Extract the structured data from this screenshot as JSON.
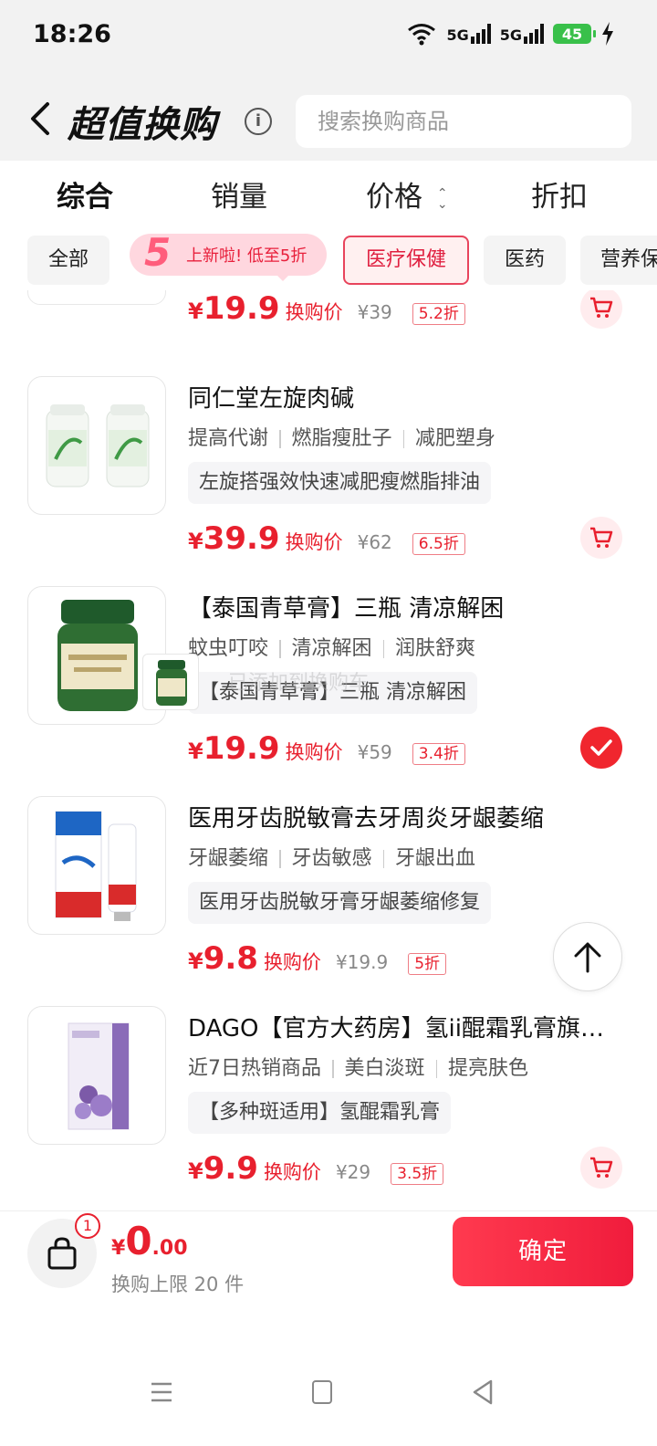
{
  "status": {
    "time": "18:26",
    "signal1": "5G",
    "signal2": "5G",
    "battery": "45"
  },
  "header": {
    "title": "超值换购",
    "search_placeholder": "搜索换购商品"
  },
  "sort": {
    "tabs": [
      "综合",
      "销量",
      "价格",
      "折扣"
    ]
  },
  "categories": [
    "全部",
    "医疗保健",
    "医药",
    "营养保健"
  ],
  "promo": {
    "num": "5",
    "text": "上新啦! 低至5折"
  },
  "items": [
    {
      "name": "",
      "tags": [],
      "desc": "",
      "price": "19.9",
      "price_label": "换购价",
      "orig": "¥39",
      "discount": "5.2折",
      "selected": false
    },
    {
      "name": "同仁堂左旋肉碱",
      "tags": [
        "提高代谢",
        "燃脂瘦肚子",
        "减肥塑身"
      ],
      "desc": "左旋搭强效快速减肥瘦燃脂排油",
      "price": "39.9",
      "price_label": "换购价",
      "orig": "¥62",
      "discount": "6.5折",
      "selected": false
    },
    {
      "name": "【泰国青草膏】三瓶 清凉解困",
      "tags": [
        "蚊虫叮咬",
        "清凉解困",
        "润肤舒爽"
      ],
      "desc": "【泰国青草膏】三瓶 清凉解困",
      "price": "19.9",
      "price_label": "换购价",
      "orig": "¥59",
      "discount": "3.4折",
      "selected": true
    },
    {
      "name": "医用牙齿脱敏膏去牙周炎牙龈萎缩",
      "tags": [
        "牙龈萎缩",
        "牙齿敏感",
        "牙龈出血"
      ],
      "desc": "医用牙齿脱敏牙膏牙龈萎缩修复",
      "price": "9.8",
      "price_label": "换购价",
      "orig": "¥19.9",
      "discount": "5折",
      "selected": false
    },
    {
      "name": "DAGO【官方大药房】氢ii醌霜乳膏旗舰店正品",
      "tags": [
        "近7日热销商品",
        "美白淡斑",
        "提亮肤色"
      ],
      "desc": "【多种斑适用】氢醌霜乳膏",
      "price": "9.9",
      "price_label": "换购价",
      "orig": "¥29",
      "discount": "3.5折",
      "selected": false
    }
  ],
  "floating": {
    "overlay_text": "已添加到换购车"
  },
  "bottom": {
    "badge": "1",
    "yen": "¥",
    "total_int": "0",
    "total_dec": ".00",
    "limit": "换购上限 20 件",
    "confirm": "确定"
  }
}
